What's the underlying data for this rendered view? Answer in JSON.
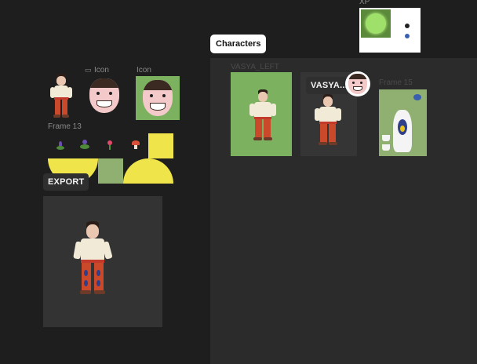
{
  "layers": {
    "icon_label_1": "Icon",
    "icon_label_2": "Icon",
    "frame13_label": "Frame 13",
    "export_label": "EXPORT",
    "xp_label": "XP"
  },
  "canvas": {
    "characters_tag": "Characters",
    "vasya_left_label": "VASYA_LEFT",
    "vasya_tag": "VASYA...",
    "frame15_label": "Frame 15"
  },
  "colors": {
    "background": "#1e1e1e",
    "panel": "#2b2b2b",
    "green": "#7cb15f",
    "yellow": "#efe54a",
    "sage": "#8fb070"
  }
}
